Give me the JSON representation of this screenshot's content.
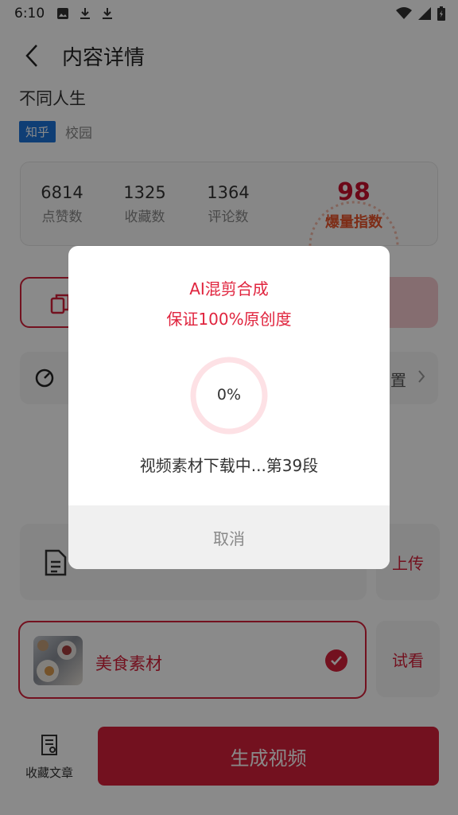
{
  "status_bar": {
    "time": "6:10"
  },
  "header": {
    "title": "内容详情"
  },
  "article": {
    "title": "不同人生",
    "tag_primary": "知乎",
    "tag_secondary": "校园"
  },
  "stats": {
    "items": [
      {
        "value": "6814",
        "label": "点赞数"
      },
      {
        "value": "1325",
        "label": "收藏数"
      },
      {
        "value": "1364",
        "label": "评论数"
      }
    ],
    "score": {
      "value": "98",
      "label": "爆量指数"
    }
  },
  "settings_row": {
    "label_fragment": "置"
  },
  "side_buttons": {
    "upload": "上传",
    "preview": "试看"
  },
  "material": {
    "name": "美食素材"
  },
  "bottom": {
    "favorite_label": "收藏文章",
    "generate_label": "生成视频"
  },
  "modal": {
    "title_line1": "AI混剪合成",
    "title_line2": "保证100%原创度",
    "progress_text": "0%",
    "progress_value": 0,
    "status": "视频素材下载中...第39段",
    "cancel_label": "取消"
  },
  "colors": {
    "accent": "#d4213a",
    "modal_accent": "#e0243e",
    "tag_blue": "#1d73d8",
    "overlay": "rgba(0,0,0,0.46)"
  }
}
